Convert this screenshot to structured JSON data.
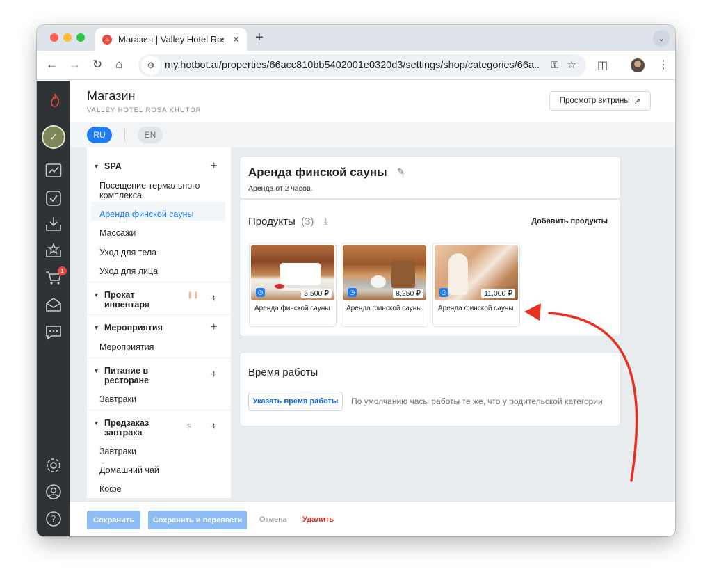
{
  "browser": {
    "tab_title": "Магазин | Valley Hotel Rosa Khutor",
    "url_host": "my.hotbot.ai",
    "url_path": "/properties/66acc810bb5402001e0320d3/settings/shop/categories/66a..."
  },
  "rail": {
    "cart_badge": "1",
    "icons": [
      "flame-logo-icon",
      "project-avatar",
      "analytics-icon",
      "tasks-icon",
      "inbox-icon",
      "reviews-icon",
      "cart-icon",
      "mail-icon",
      "chat-icon",
      "settings-icon",
      "profile-icon",
      "help-icon"
    ]
  },
  "header": {
    "title": "Магазин",
    "subtitle": "VALLEY HOTEL ROSA KHUTOR",
    "storefront_button": "Просмотр витрины"
  },
  "languages": {
    "ru": "RU",
    "en": "EN"
  },
  "categories": [
    {
      "name": "SPA",
      "items": [
        "Посещение термального комплекса",
        "Аренда финской сауны",
        "Массажи",
        "Уход для тела",
        "Уход для лица"
      ]
    },
    {
      "name": "Прокат инвентаря",
      "items": []
    },
    {
      "name": "Мероприятия",
      "items": [
        "Мероприятия"
      ]
    },
    {
      "name": "Питание в ресторане",
      "items": [
        "Завтраки"
      ]
    },
    {
      "name": "Предзаказ завтрака",
      "mark": "$",
      "items": [
        "Завтраки",
        "Домашний чай",
        "Кофе"
      ]
    }
  ],
  "category_detail": {
    "title": "Аренда финской сауны",
    "description": "Аренда от 2 часов."
  },
  "products": {
    "heading": "Продукты",
    "count": "(3)",
    "add_label": "Добавить продукты",
    "items": [
      {
        "name": "Аренда финской сауны",
        "price": "5,500 ₽"
      },
      {
        "name": "Аренда финской сауны",
        "price": "8,250 ₽"
      },
      {
        "name": "Аренда финской сауны",
        "price": "11,000 ₽"
      }
    ]
  },
  "work_hours": {
    "heading": "Время работы",
    "button": "Указать время работы",
    "note": "По умолчанию часы работы те же, что у родительской категории"
  },
  "footer": {
    "save": "Сохранить",
    "save_translate": "Сохранить и перевести",
    "cancel": "Отмена",
    "delete": "Удалить"
  },
  "colors": {
    "accent": "#1f7bf2",
    "danger": "#e5332a",
    "rail": "#2e3336",
    "annotation_arrow": "#e8321f"
  }
}
